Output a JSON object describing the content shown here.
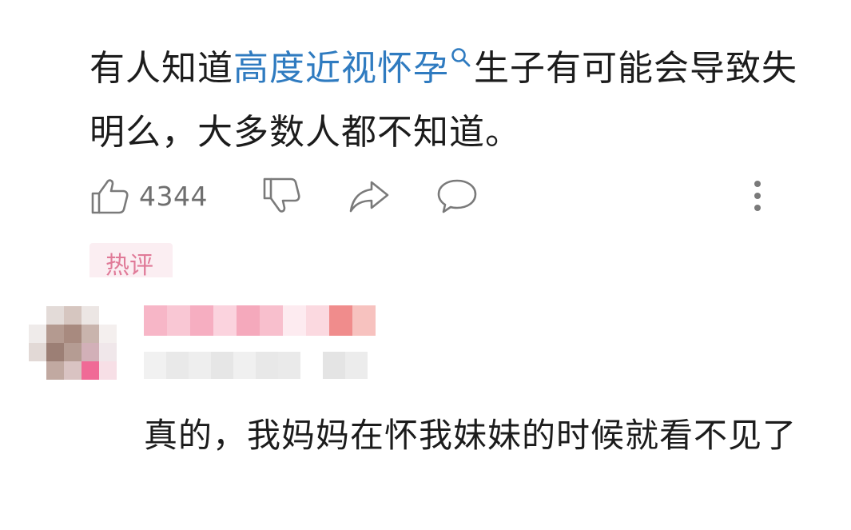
{
  "post": {
    "text_before": "有人知道",
    "keyword": "高度近视怀孕",
    "text_after": "生子有可能会导致失明么，大多数人都不知道。"
  },
  "actions": {
    "like_count": "4344"
  },
  "comments": {
    "tab_label": "热评",
    "items": [
      {
        "text": "真的，我妈妈在怀我妹妹的时候就看不见了"
      }
    ]
  },
  "colors": {
    "keyword": "#2f7bc0",
    "icon": "#7a7a7a",
    "tag_background": "#fbeef2",
    "tag_text": "#e07a98"
  }
}
